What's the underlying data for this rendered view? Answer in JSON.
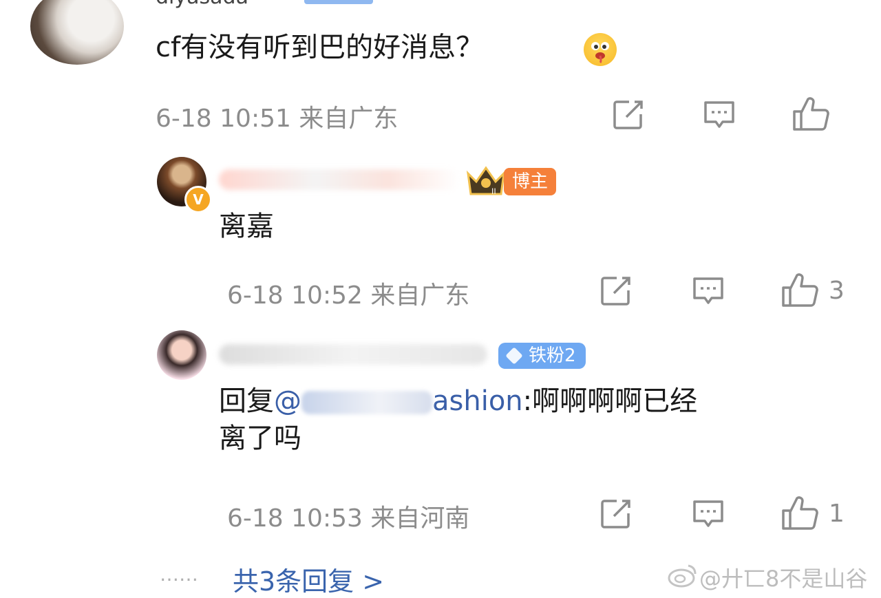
{
  "comments": [
    {
      "username": "diyasada",
      "text": "cf有没有听到巴的好消息？",
      "emoji": "drooling-face-emoji",
      "time": "6-18 10:51",
      "location": "来自广东",
      "likes": ""
    },
    {
      "username_visible": "",
      "badge": "博主",
      "text": "离嘉",
      "time": "6-18 10:52",
      "location": "来自广东",
      "likes": "3"
    },
    {
      "username_visible": "",
      "badge": "铁粉2",
      "reply_prefix": "回复",
      "mention": "@",
      "mention_visible_suffix": "ashion",
      "text_line1": ":啊啊啊啊已经",
      "text_line2": "离了吗",
      "time": "6-18 10:53",
      "location": "来自河南",
      "likes": "1"
    }
  ],
  "more_dots": "……",
  "more_replies": "共3条回复 >",
  "watermark": "@廾匸8不是山谷",
  "colors": {
    "accent_blue": "#3a64ad",
    "meta_gray": "#8c8c8c",
    "fan_badge": "#6ea8f2",
    "host_badge": "#f5803a"
  }
}
